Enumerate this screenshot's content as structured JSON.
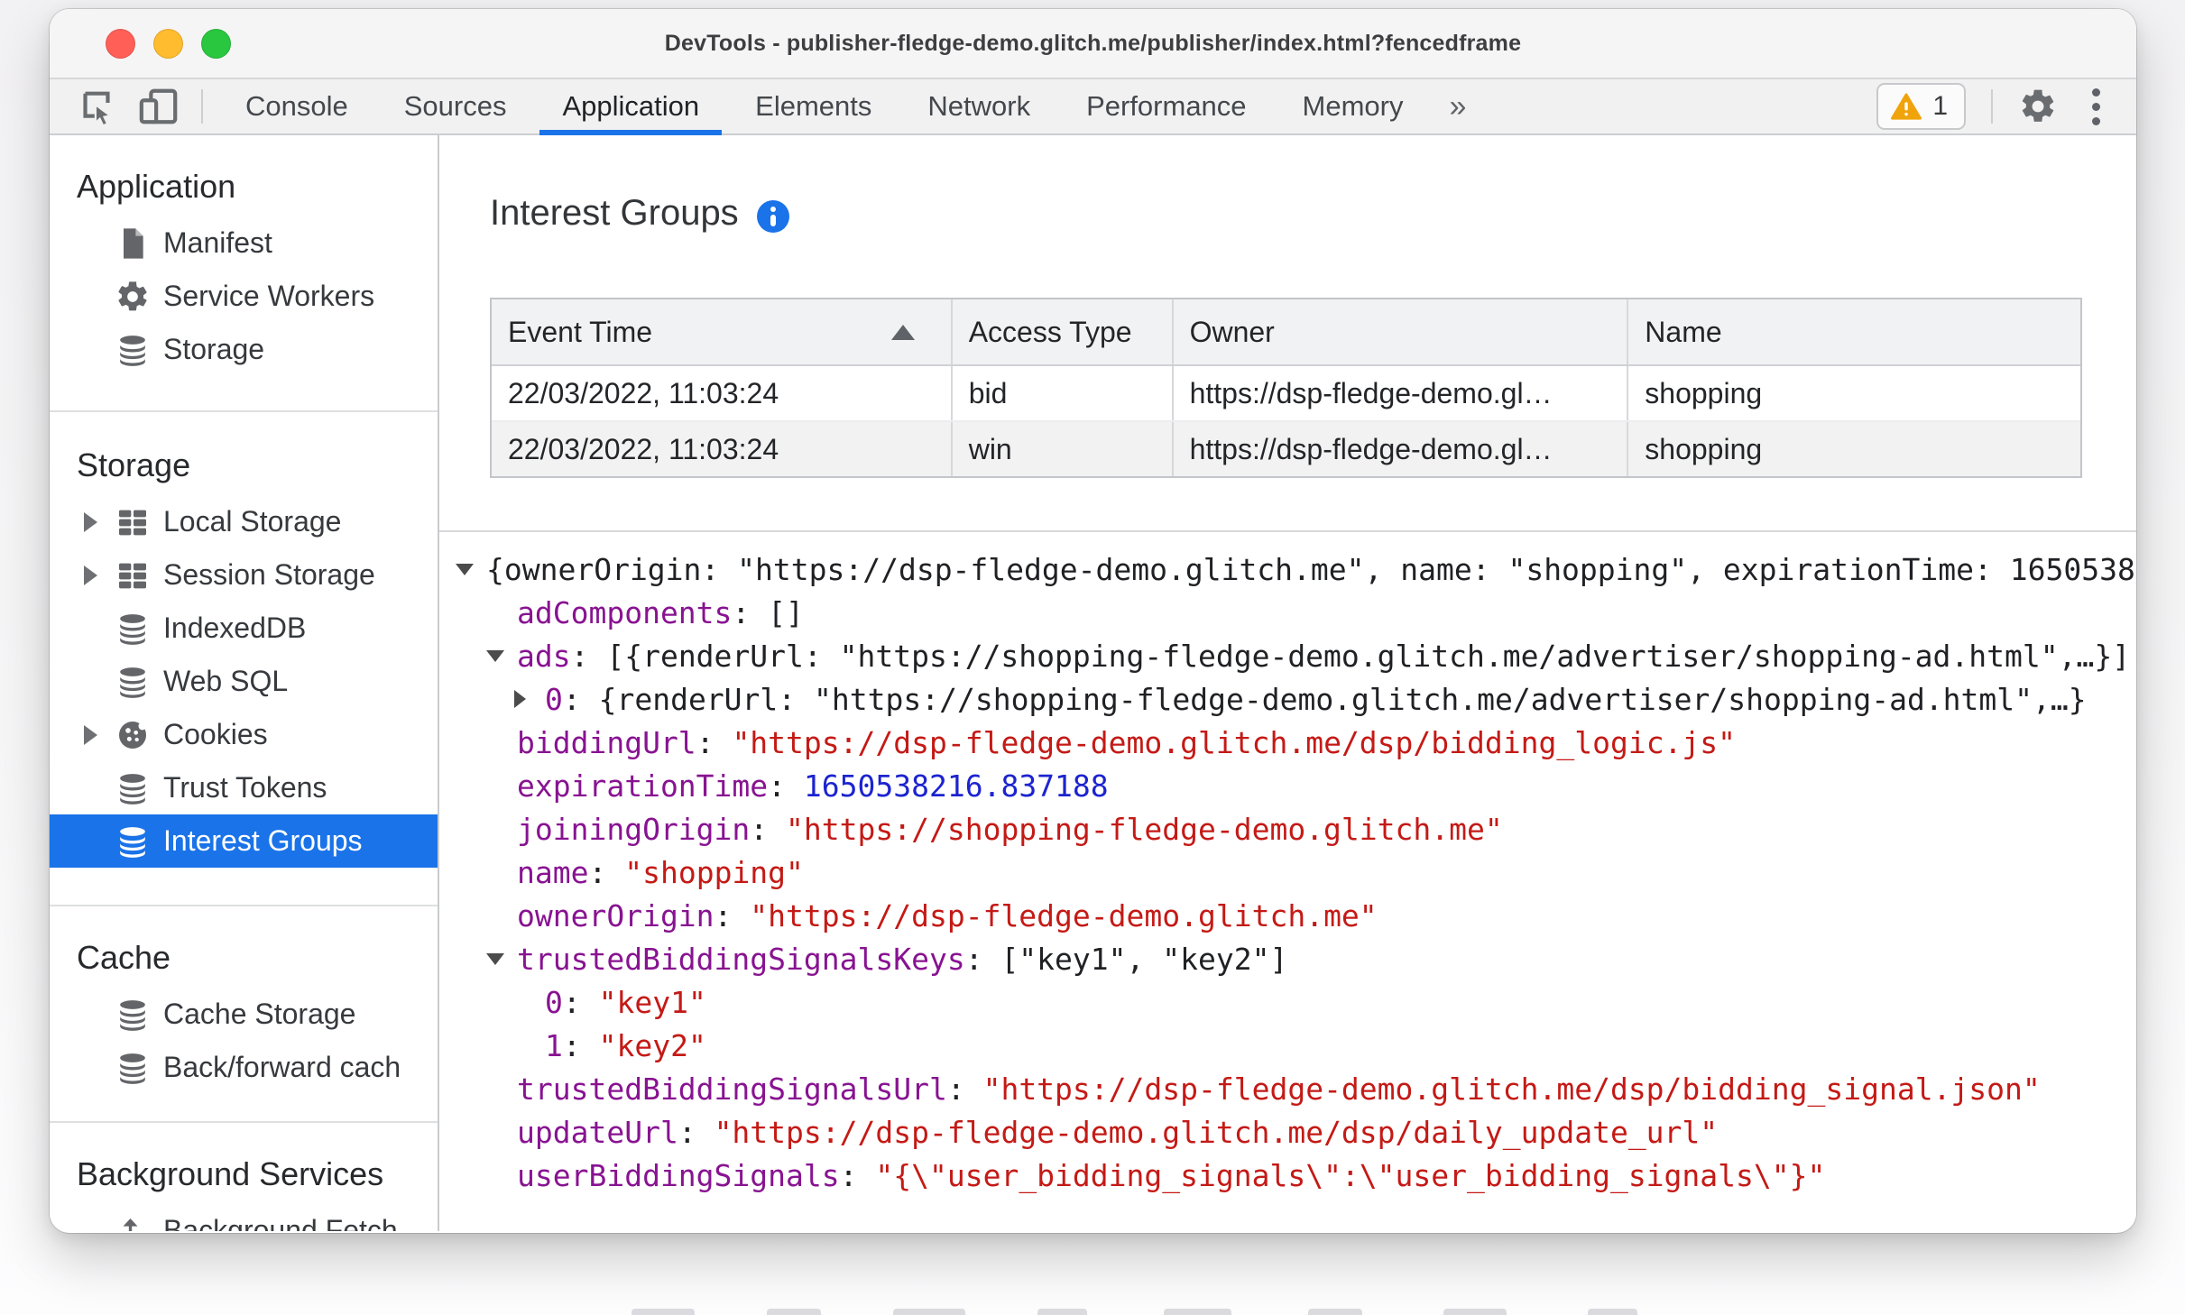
{
  "window": {
    "title": "DevTools - publisher-fledge-demo.glitch.me/publisher/index.html?fencedframe",
    "traffic_lights": [
      "close",
      "minimize",
      "zoom"
    ]
  },
  "toolbar": {
    "left_icons": [
      "inspect-icon",
      "device-toolbar-icon"
    ],
    "tabs": [
      "Console",
      "Sources",
      "Application",
      "Elements",
      "Network",
      "Performance",
      "Memory"
    ],
    "active_tab": "Application",
    "overflow_label": "»",
    "issues": {
      "warning_count": "1"
    },
    "right_icons": [
      "warning-icon",
      "gear-icon",
      "kebab-menu-icon"
    ]
  },
  "sidebar": {
    "sections": [
      {
        "title": "Application",
        "items": [
          {
            "label": "Manifest",
            "icon": "document"
          },
          {
            "label": "Service Workers",
            "icon": "gear"
          },
          {
            "label": "Storage",
            "icon": "database"
          }
        ]
      },
      {
        "title": "Storage",
        "items": [
          {
            "label": "Local Storage",
            "icon": "table",
            "expandable": true
          },
          {
            "label": "Session Storage",
            "icon": "table",
            "expandable": true
          },
          {
            "label": "IndexedDB",
            "icon": "database"
          },
          {
            "label": "Web SQL",
            "icon": "database"
          },
          {
            "label": "Cookies",
            "icon": "cookie",
            "expandable": true
          },
          {
            "label": "Trust Tokens",
            "icon": "database"
          },
          {
            "label": "Interest Groups",
            "icon": "database",
            "selected": true
          }
        ]
      },
      {
        "title": "Cache",
        "items": [
          {
            "label": "Cache Storage",
            "icon": "database"
          },
          {
            "label": "Back/forward cach",
            "icon": "database"
          }
        ]
      },
      {
        "title": "Background Services",
        "items": [
          {
            "label": "Background Fetch",
            "icon": "fetch"
          }
        ]
      }
    ]
  },
  "main": {
    "heading": "Interest Groups",
    "info_icon": "info-icon",
    "table": {
      "columns": [
        "Event Time",
        "Access Type",
        "Owner",
        "Name"
      ],
      "sort": {
        "column": "Event Time",
        "direction": "ascending"
      },
      "rows": [
        [
          "22/03/2022, 11:03:24",
          "bid",
          "https://dsp-fledge-demo.gl…",
          "shopping"
        ],
        [
          "22/03/2022, 11:03:24",
          "win",
          "https://dsp-fledge-demo.gl…",
          "shopping"
        ]
      ]
    },
    "tree": {
      "lines": [
        {
          "indent": 0,
          "arrow": "down",
          "segments": [
            {
              "t": "{ownerOrigin: \"https://dsp-fledge-demo.glitch.me\", name: \"shopping\", expirationTime: 1650538",
              "c": "plain"
            }
          ]
        },
        {
          "indent": 1,
          "arrow": null,
          "segments": [
            {
              "t": "adComponents",
              "c": "key"
            },
            {
              "t": ": []",
              "c": "plain"
            }
          ]
        },
        {
          "indent": 1,
          "arrow": "down",
          "segments": [
            {
              "t": "ads",
              "c": "key"
            },
            {
              "t": ": [{renderUrl: \"https://shopping-fledge-demo.glitch.me/advertiser/shopping-ad.html\",…}]",
              "c": "plain"
            }
          ]
        },
        {
          "indent": 2,
          "arrow": "right",
          "segments": [
            {
              "t": "0",
              "c": "key"
            },
            {
              "t": ": {renderUrl: \"https://shopping-fledge-demo.glitch.me/advertiser/shopping-ad.html\",…}",
              "c": "plain"
            }
          ]
        },
        {
          "indent": 1,
          "arrow": null,
          "segments": [
            {
              "t": "biddingUrl",
              "c": "key"
            },
            {
              "t": ": ",
              "c": "plain"
            },
            {
              "t": "\"https://dsp-fledge-demo.glitch.me/dsp/bidding_logic.js\"",
              "c": "string"
            }
          ]
        },
        {
          "indent": 1,
          "arrow": null,
          "segments": [
            {
              "t": "expirationTime",
              "c": "key"
            },
            {
              "t": ": ",
              "c": "plain"
            },
            {
              "t": "1650538216.837188",
              "c": "number"
            }
          ]
        },
        {
          "indent": 1,
          "arrow": null,
          "segments": [
            {
              "t": "joiningOrigin",
              "c": "key"
            },
            {
              "t": ": ",
              "c": "plain"
            },
            {
              "t": "\"https://shopping-fledge-demo.glitch.me\"",
              "c": "string"
            }
          ]
        },
        {
          "indent": 1,
          "arrow": null,
          "segments": [
            {
              "t": "name",
              "c": "key"
            },
            {
              "t": ": ",
              "c": "plain"
            },
            {
              "t": "\"shopping\"",
              "c": "string"
            }
          ]
        },
        {
          "indent": 1,
          "arrow": null,
          "segments": [
            {
              "t": "ownerOrigin",
              "c": "key"
            },
            {
              "t": ": ",
              "c": "plain"
            },
            {
              "t": "\"https://dsp-fledge-demo.glitch.me\"",
              "c": "string"
            }
          ]
        },
        {
          "indent": 1,
          "arrow": "down",
          "segments": [
            {
              "t": "trustedBiddingSignalsKeys",
              "c": "key"
            },
            {
              "t": ": [\"key1\", \"key2\"]",
              "c": "plain"
            }
          ]
        },
        {
          "indent": 2,
          "arrow": null,
          "segments": [
            {
              "t": "0",
              "c": "key"
            },
            {
              "t": ": ",
              "c": "plain"
            },
            {
              "t": "\"key1\"",
              "c": "string"
            }
          ]
        },
        {
          "indent": 2,
          "arrow": null,
          "segments": [
            {
              "t": "1",
              "c": "key"
            },
            {
              "t": ": ",
              "c": "plain"
            },
            {
              "t": "\"key2\"",
              "c": "string"
            }
          ]
        },
        {
          "indent": 1,
          "arrow": null,
          "segments": [
            {
              "t": "trustedBiddingSignalsUrl",
              "c": "key"
            },
            {
              "t": ": ",
              "c": "plain"
            },
            {
              "t": "\"https://dsp-fledge-demo.glitch.me/dsp/bidding_signal.json\"",
              "c": "string"
            }
          ]
        },
        {
          "indent": 1,
          "arrow": null,
          "segments": [
            {
              "t": "updateUrl",
              "c": "key"
            },
            {
              "t": ": ",
              "c": "plain"
            },
            {
              "t": "\"https://dsp-fledge-demo.glitch.me/dsp/daily_update_url\"",
              "c": "string"
            }
          ]
        },
        {
          "indent": 1,
          "arrow": null,
          "segments": [
            {
              "t": "userBiddingSignals",
              "c": "key"
            },
            {
              "t": ": ",
              "c": "plain"
            },
            {
              "t": "\"{\\\"user_bidding_signals\\\":\\\"user_bidding_signals\\\"}\"",
              "c": "string"
            }
          ]
        }
      ]
    }
  },
  "colors": {
    "accent_blue": "#1a73e8",
    "selection_blue": "#1a73e8",
    "syntax_key_purple": "#881391",
    "syntax_string_red": "#c41a16",
    "syntax_number_blue": "#1c24cf",
    "warning_yellow": "#f0a30a",
    "traffic_red": "#ff5f57",
    "traffic_yellow": "#febc2e",
    "traffic_green": "#29c73f"
  }
}
